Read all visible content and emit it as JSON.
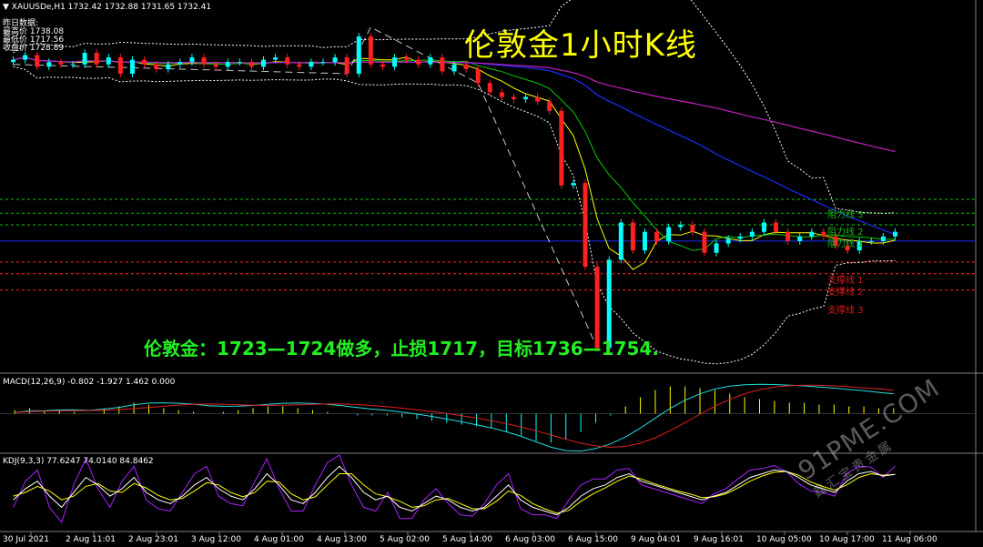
{
  "header": {
    "symbol_line": "▼ XAUUSDe,H1  1732.42 1732.88 1731.65 1732.41",
    "prev_data_label": "昨日数据:",
    "prev_open": "最高价 1738.08",
    "prev_low": "最低价 1717.56",
    "prev_close": "收盘价 1728.89"
  },
  "title": "伦敦金1小时K线",
  "strategy": "伦敦金：1723—1724做多，止损1717，目标1736—1754.",
  "levels": {
    "resistance": [
      {
        "label": "阻力线 3",
        "color": "#1db41d"
      },
      {
        "label": "阻力线 2",
        "color": "#1db41d"
      },
      {
        "label": "阻力线 1",
        "color": "#1db41d"
      }
    ],
    "support": [
      {
        "label": "支撑线 1",
        "color": "#d41c1c"
      },
      {
        "label": "支撑线 2",
        "color": "#d41c1c"
      },
      {
        "label": "支撑线 3",
        "color": "#d41c1c"
      }
    ]
  },
  "indicators": {
    "macd_label": "MACD(12,26,9) -0.802 -1.927 1.462 0.000",
    "kdj_label": "KDJ(9,3,3) 77.6247 74.0140 84.8462"
  },
  "watermark": {
    "main": "91PME.COM",
    "sub": "鑫汇宝贵金属"
  },
  "chart_data": {
    "type": "line",
    "title": "伦敦金1小时K线",
    "symbol": "XAUUSDe,H1",
    "x_tick_labels": [
      "30 Jul 2021",
      "2 Aug 11:01",
      "2 Aug 23:01",
      "3 Aug 12:00",
      "4 Aug 01:00",
      "4 Aug 13:00",
      "5 Aug 02:00",
      "5 Aug 14:00",
      "6 Aug 03:00",
      "6 Aug 15:00",
      "9 Aug 04:01",
      "9 Aug 16:01",
      "10 Aug 05:00",
      "10 Aug 17:00",
      "11 Aug 06:00"
    ],
    "ylim": [
      1680,
      1835
    ],
    "level_values": {
      "resistance_3": 1754,
      "resistance_2": 1748,
      "resistance_1": 1743,
      "pivot": 1736,
      "support_1": 1727,
      "support_2": 1722,
      "support_3": 1715
    },
    "price_series": [
      {
        "name": "close",
        "values": [
          1814,
          1816,
          1811,
          1813,
          1812,
          1812,
          1817,
          1812,
          1815,
          1808,
          1814,
          1812,
          1810,
          1812,
          1813,
          1815,
          1812,
          1811,
          1813,
          1813,
          1811,
          1814,
          1815,
          1812,
          1811,
          1813,
          1813,
          1815,
          1808,
          1824,
          1812,
          1811,
          1815,
          1814,
          1812,
          1815,
          1809,
          1812,
          1810,
          1804,
          1800,
          1798,
          1797,
          1798,
          1796,
          1792,
          1760,
          1761,
          1725,
          1690,
          1728,
          1744,
          1732,
          1740,
          1736,
          1742,
          1743,
          1740,
          1731,
          1735,
          1737,
          1738,
          1740,
          1744,
          1740,
          1736,
          1738,
          1740,
          1738,
          1734,
          1732,
          1736,
          1736,
          1738,
          1740
        ]
      }
    ],
    "macd": {
      "label": "MACD(12,26,9)",
      "values": [
        -0.802,
        -1.927,
        1.462,
        0.0
      ],
      "histogram": [
        0.2,
        0.3,
        0.1,
        0.2,
        0.1,
        0.0,
        0.3,
        0.4,
        0.6,
        0.5,
        0.3,
        0.2,
        0.1,
        0.0,
        0.1,
        0.2,
        0.3,
        0.4,
        0.4,
        0.3,
        0.2,
        0.1,
        0.0,
        -0.1,
        -0.1,
        -0.1,
        -0.2,
        -0.3,
        -0.4,
        -0.5,
        -0.6,
        -0.7,
        -0.8,
        -1.0,
        -1.2,
        -1.5,
        -1.6,
        -1.4,
        -1.0,
        -0.5,
        -0.1,
        0.4,
        0.9,
        1.3,
        1.5,
        1.5,
        1.4,
        1.3,
        1.1,
        0.9,
        0.8,
        0.7,
        0.6,
        0.6,
        0.5,
        0.5,
        0.4,
        0.4,
        0.3,
        0.3
      ]
    },
    "kdj": {
      "label": "KDJ(9,3,3)",
      "values": [
        77.6247,
        74.014,
        84.8462
      ],
      "ylim": [
        0,
        100
      ],
      "k": [
        40,
        55,
        65,
        45,
        30,
        50,
        70,
        60,
        45,
        55,
        70,
        50,
        40,
        35,
        45,
        60,
        70,
        55,
        45,
        40,
        55,
        75,
        60,
        40,
        35,
        50,
        70,
        85,
        70,
        50,
        40,
        45,
        30,
        25,
        35,
        45,
        40,
        30,
        25,
        30,
        45,
        60,
        40,
        30,
        25,
        20,
        30,
        45,
        55,
        60,
        70,
        75,
        65,
        60,
        55,
        50,
        45,
        40,
        45,
        50,
        60,
        70,
        75,
        80,
        78,
        70,
        60,
        55,
        50,
        65,
        75,
        78,
        72,
        74
      ],
      "d": [
        45,
        50,
        58,
        52,
        40,
        45,
        58,
        62,
        52,
        50,
        62,
        56,
        46,
        40,
        42,
        52,
        63,
        60,
        50,
        44,
        50,
        65,
        64,
        48,
        40,
        44,
        60,
        75,
        75,
        60,
        48,
        44,
        38,
        30,
        32,
        40,
        42,
        35,
        28,
        28,
        38,
        52,
        46,
        35,
        28,
        22,
        26,
        38,
        48,
        56,
        65,
        72,
        68,
        62,
        57,
        52,
        48,
        43,
        44,
        48,
        56,
        65,
        72,
        77,
        78,
        73,
        64,
        58,
        53,
        60,
        70,
        75,
        73,
        74
      ],
      "j": [
        30,
        65,
        80,
        30,
        10,
        60,
        95,
        55,
        30,
        65,
        85,
        40,
        28,
        25,
        50,
        75,
        85,
        45,
        35,
        32,
        65,
        95,
        55,
        25,
        25,
        60,
        90,
        100,
        60,
        30,
        25,
        50,
        15,
        15,
        40,
        55,
        35,
        20,
        18,
        35,
        60,
        75,
        28,
        20,
        20,
        15,
        40,
        60,
        68,
        68,
        80,
        82,
        60,
        55,
        50,
        45,
        40,
        35,
        48,
        55,
        68,
        80,
        82,
        86,
        78,
        62,
        52,
        50,
        45,
        75,
        85,
        84,
        70,
        85
      ]
    }
  },
  "colors": {
    "background": "#000000",
    "bull_candle": "#00ffff",
    "bear_candle": "#ff2020",
    "ma_fast": "#ffff00",
    "ma_mid": "#00cc00",
    "ma_slow": "#1c2cff",
    "ma_long": "#c020c0",
    "bands": "#ffffff",
    "macd_line": "#22dddd",
    "signal_line": "#dd2222",
    "kdj_k": "#ffffff",
    "kdj_d": "#ffff00",
    "kdj_j": "#aa22ff",
    "divider": "#808080"
  }
}
